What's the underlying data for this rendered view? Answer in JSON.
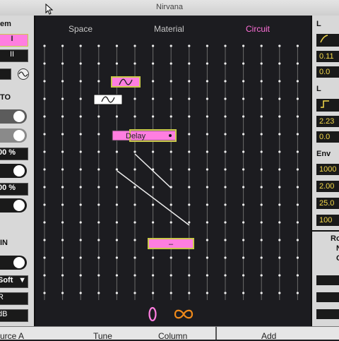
{
  "window": {
    "title": "Nirvana"
  },
  "tabs": [
    {
      "label": "Space",
      "color": "#c8c8c8"
    },
    {
      "label": "Material",
      "color": "#c8c8c8"
    },
    {
      "label": "Circuit",
      "color": "#ff6fd8"
    }
  ],
  "left_panel": {
    "header": "em",
    "mono_label": "I",
    "stereo_label": "II",
    "section_to": "TO",
    "percent_1": "00 %",
    "percent_2": "00 %",
    "section_in": "IN",
    "mode_select": "Soft",
    "r_label": "R",
    "db_label": "dB"
  },
  "right_panel": {
    "header_1": "L",
    "value_1": "0.11",
    "value_2": "0.0",
    "header_2": "L",
    "value_3": "2.23",
    "value_4": "0.0",
    "header_env": "Env",
    "value_5": "1000",
    "value_6": "2.00",
    "value_7": "25.0",
    "value_8": "100",
    "label_ro": "Ro",
    "label_n": "N",
    "label_c": "C"
  },
  "circuit": {
    "delay_label": "Delay",
    "minus_label": "–",
    "accent": "#ff7ee0",
    "highlight": "#c9c94a"
  },
  "footer": {
    "source": "urce A",
    "tune": "Tune",
    "column": "Column",
    "add": "Add"
  },
  "icons": {
    "waveform_small": "sine-wave-icon",
    "feedback": "feedback-icon",
    "infinity": "infinity-icon"
  }
}
